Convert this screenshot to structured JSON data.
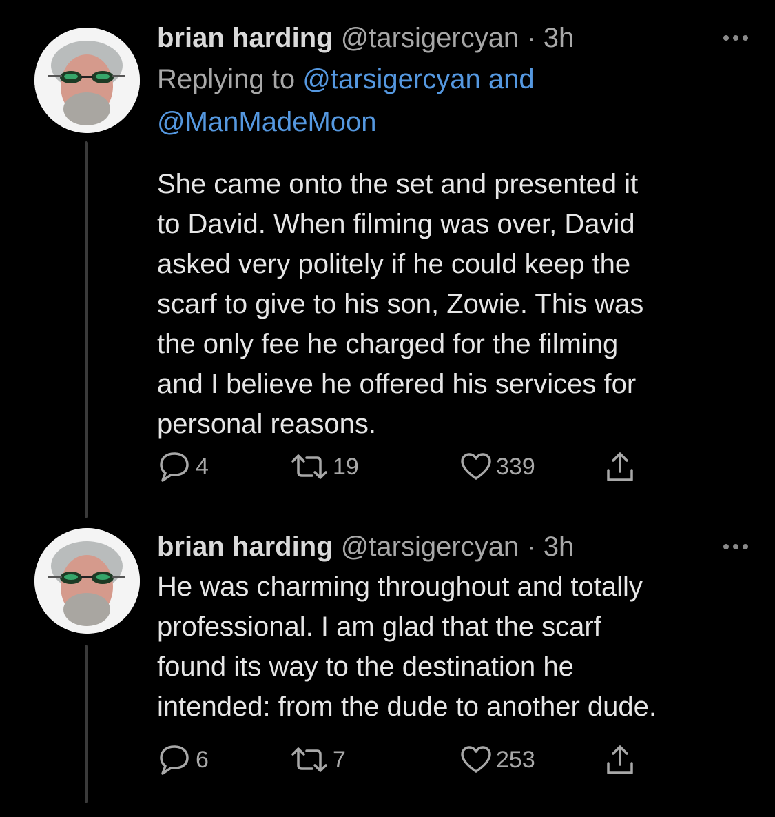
{
  "tweets": [
    {
      "author_name": "brian harding",
      "handle": "@tarsigercyan",
      "separator": "·",
      "time": "3h",
      "replying_prefix": "Replying to",
      "reply_mention_1": "@tarsigercyan and",
      "reply_mention_2": "@ManMadeMoon",
      "text": "She came onto the set and presented it\nto David. When filming was over, David\nasked very politely if he could keep the\nscarf to give to his son, Zowie. This was\nthe only fee he charged for the filming\nand I believe he offered his services for\npersonal reasons.",
      "replies": "4",
      "retweets": "19",
      "likes": "339"
    },
    {
      "author_name": "brian harding",
      "handle": "@tarsigercyan",
      "separator": "·",
      "time": "3h",
      "text": "He was charming throughout and totally\nprofessional. I am glad that the scarf\nfound its way to the destination he\nintended: from the dude to another dude.",
      "replies": "6",
      "retweets": "7",
      "likes": "253"
    }
  ],
  "icons": {
    "reply": "comment-bubble-icon",
    "retweet": "retweet-icon",
    "like": "heart-icon",
    "share": "share-icon",
    "more": "more-options-icon"
  },
  "colors": {
    "background": "#000000",
    "primary_text": "#e6e6e6",
    "secondary_text": "#a8a8a8",
    "link": "#5598e0",
    "thread_line": "#3a3a3a"
  }
}
